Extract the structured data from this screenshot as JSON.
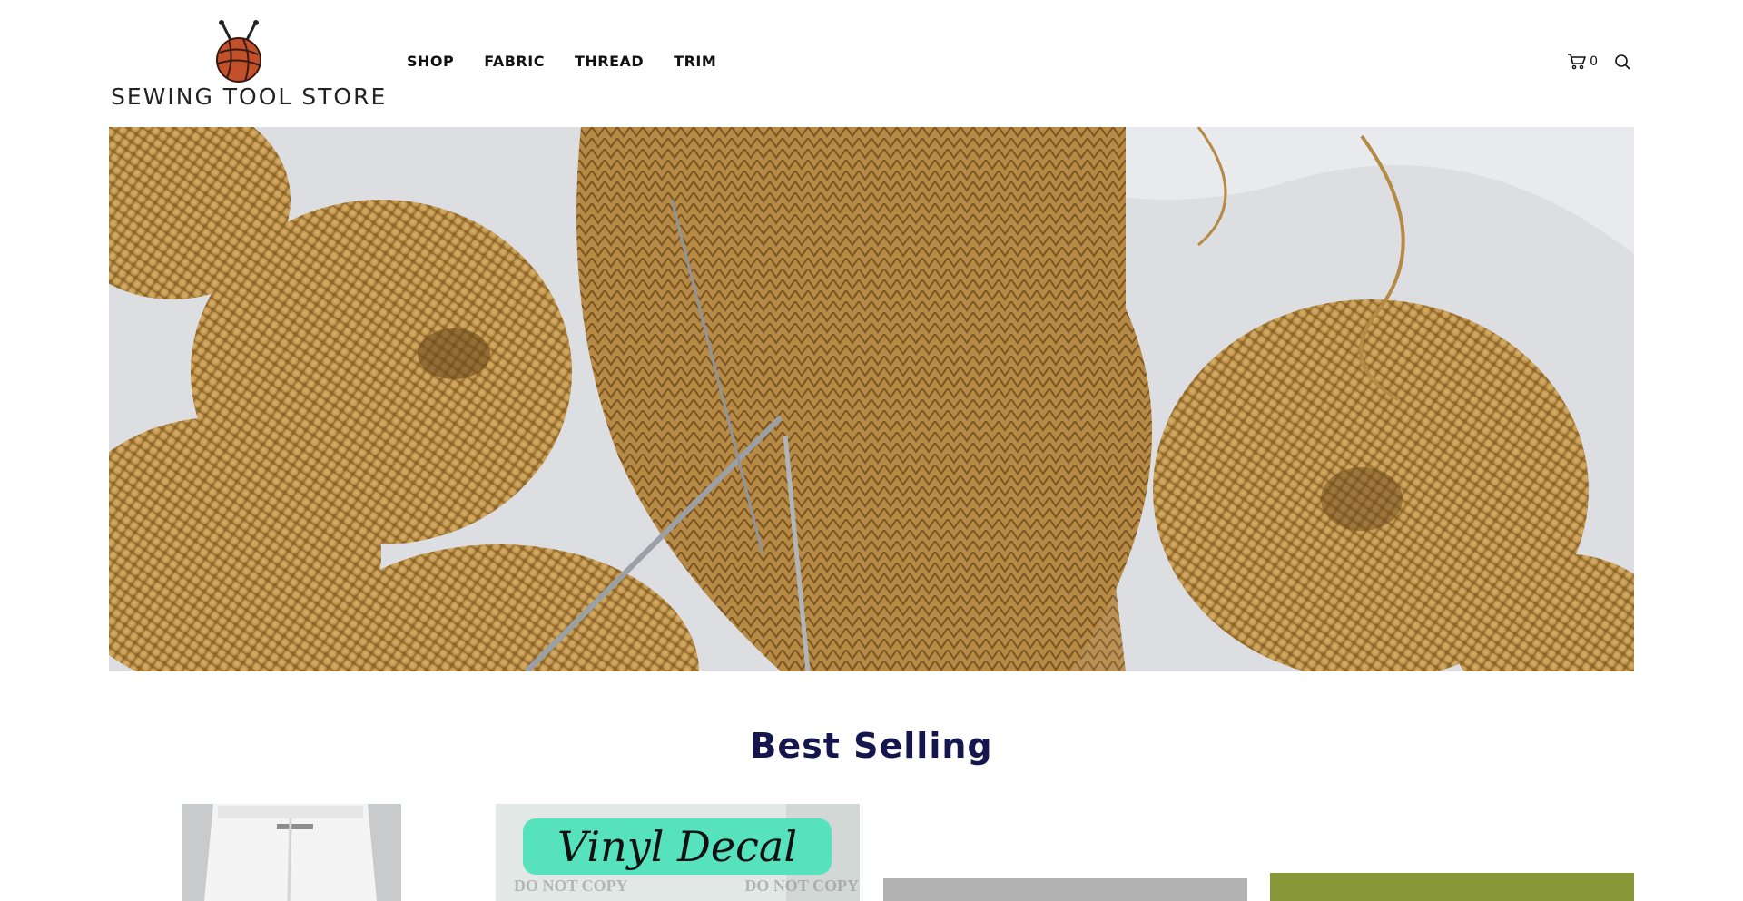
{
  "store": {
    "name": "SEWING TOOL STORE",
    "logo_icon": "yarn-ball-with-needles-icon",
    "logo_color": "#c1502b"
  },
  "nav": {
    "items": [
      {
        "label": "SHOP"
      },
      {
        "label": "FABRIC"
      },
      {
        "label": "THREAD"
      },
      {
        "label": "TRIM"
      }
    ]
  },
  "header_tools": {
    "cart_icon": "cart-icon",
    "cart_count": "0",
    "search_icon": "search-icon"
  },
  "hero": {
    "image": "knitting-yarn-hero-image",
    "yarn_color": "#c49a52"
  },
  "best_selling": {
    "title": "Best Selling",
    "title_color": "#16164f",
    "products": [
      {
        "image": "white-pants-product-image"
      },
      {
        "image": "vinyl-decal-product-image",
        "overlay_text": "Vinyl Decal",
        "watermark_left": "DO NOT COPY",
        "watermark_right": "DO NOT COPY"
      },
      {
        "image": "gray-fabric-product-image"
      },
      {
        "image": "green-fabric-product-image"
      }
    ]
  }
}
